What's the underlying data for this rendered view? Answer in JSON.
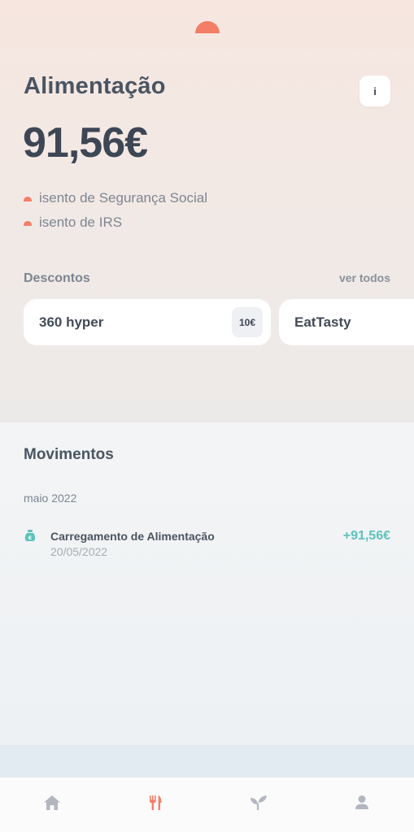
{
  "screen": {
    "title": "Alimentação",
    "info_label": "i",
    "balance": "91,56€",
    "perks": [
      "isento de Segurança Social",
      "isento de IRS"
    ]
  },
  "discounts": {
    "label": "Descontos",
    "see_all": "ver todos",
    "cards": [
      {
        "name": "360 hyper",
        "badge": "10€"
      },
      {
        "name": "EatTasty"
      }
    ]
  },
  "movements": {
    "title": "Movimentos",
    "groups": [
      {
        "month": "maio 2022",
        "items": [
          {
            "icon": "money-bag-icon",
            "description": "Carregamento de Alimentação",
            "date": "20/05/2022",
            "amount": "+91,56€"
          }
        ]
      }
    ]
  },
  "nav": {
    "items": [
      {
        "icon": "home-icon",
        "active": false
      },
      {
        "icon": "fork-knife-icon",
        "active": true
      },
      {
        "icon": "sprout-icon",
        "active": false
      },
      {
        "icon": "user-icon",
        "active": false
      }
    ]
  },
  "colors": {
    "accent": "#f47d67",
    "positive": "#5ec2bd",
    "inactive_icon": "#b2b7bf",
    "text_dark": "#3d4654"
  }
}
